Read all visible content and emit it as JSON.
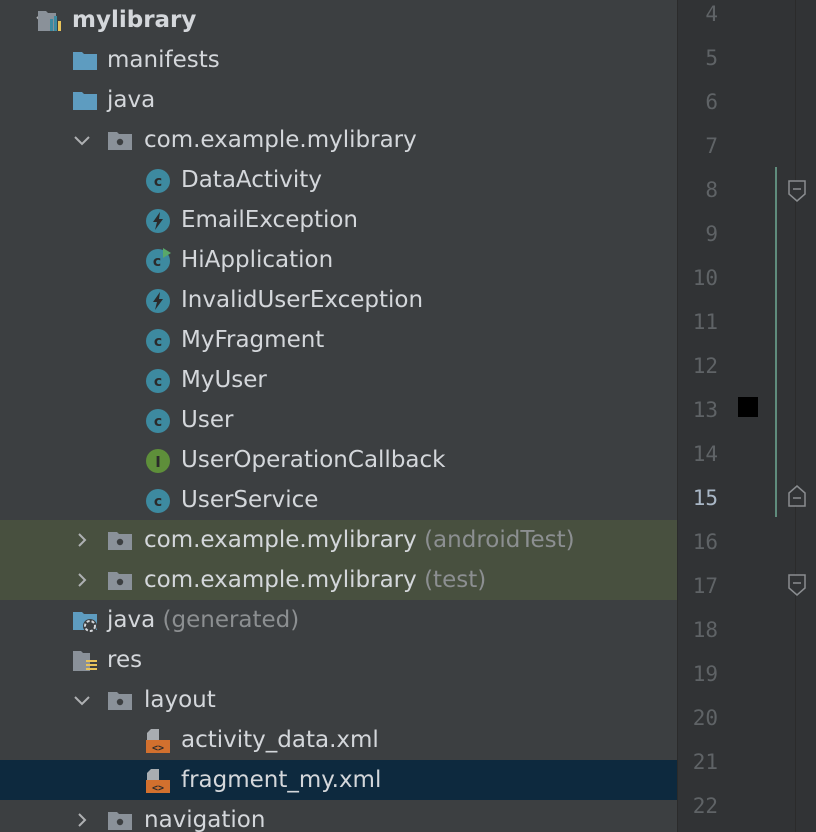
{
  "tree": {
    "rows": [
      {
        "label": "mylibrary",
        "hint": "",
        "bold": true,
        "indent": 0,
        "arrow": "down",
        "icon": "module-folder-icon",
        "style": ""
      },
      {
        "label": "manifests",
        "hint": "",
        "indent": 1,
        "arrow": "right",
        "icon": "folder-icon",
        "style": ""
      },
      {
        "label": "java",
        "hint": "",
        "indent": 1,
        "arrow": "down",
        "icon": "folder-icon",
        "style": ""
      },
      {
        "label": "com.example.mylibrary",
        "hint": "",
        "indent": 2,
        "arrow": "down",
        "icon": "package-icon",
        "style": ""
      },
      {
        "label": "DataActivity",
        "hint": "",
        "indent": 3,
        "arrow": "",
        "icon": "class-icon",
        "style": ""
      },
      {
        "label": "EmailException",
        "hint": "",
        "indent": 3,
        "arrow": "",
        "icon": "exception-icon",
        "style": ""
      },
      {
        "label": "HiApplication",
        "hint": "",
        "indent": 3,
        "arrow": "",
        "icon": "runnable-class-icon",
        "style": ""
      },
      {
        "label": "InvalidUserException",
        "hint": "",
        "indent": 3,
        "arrow": "",
        "icon": "exception-icon",
        "style": ""
      },
      {
        "label": "MyFragment",
        "hint": "",
        "indent": 3,
        "arrow": "",
        "icon": "class-icon",
        "style": ""
      },
      {
        "label": "MyUser",
        "hint": "",
        "indent": 3,
        "arrow": "",
        "icon": "class-icon",
        "style": ""
      },
      {
        "label": "User",
        "hint": "",
        "indent": 3,
        "arrow": "",
        "icon": "class-icon",
        "style": ""
      },
      {
        "label": "UserOperationCallback",
        "hint": "",
        "indent": 3,
        "arrow": "",
        "icon": "interface-icon",
        "style": ""
      },
      {
        "label": "UserService",
        "hint": "",
        "indent": 3,
        "arrow": "",
        "icon": "class-icon",
        "style": ""
      },
      {
        "label": "com.example.mylibrary",
        "hint": "(androidTest)",
        "indent": 2,
        "arrow": "right",
        "icon": "package-icon",
        "style": "tinted"
      },
      {
        "label": "com.example.mylibrary",
        "hint": "(test)",
        "indent": 2,
        "arrow": "right",
        "icon": "package-icon",
        "style": "tinted"
      },
      {
        "label": "java",
        "hint": "(generated)",
        "indent": 1,
        "arrow": "",
        "icon": "generated-folder-icon",
        "style": ""
      },
      {
        "label": "res",
        "hint": "",
        "indent": 1,
        "arrow": "down",
        "icon": "res-folder-icon",
        "style": ""
      },
      {
        "label": "layout",
        "hint": "",
        "indent": 2,
        "arrow": "down",
        "icon": "package-icon",
        "style": ""
      },
      {
        "label": "activity_data.xml",
        "hint": "",
        "indent": 3,
        "arrow": "",
        "icon": "layout-xml-icon",
        "style": ""
      },
      {
        "label": "fragment_my.xml",
        "hint": "",
        "indent": 3,
        "arrow": "",
        "icon": "layout-xml-icon",
        "style": "selected"
      },
      {
        "label": "navigation",
        "hint": "",
        "indent": 2,
        "arrow": "right",
        "icon": "package-icon",
        "style": ""
      }
    ]
  },
  "gutter": {
    "line_numbers": [
      "4",
      "5",
      "6",
      "7",
      "8",
      "9",
      "10",
      "11",
      "12",
      "13",
      "14",
      "15",
      "16",
      "17",
      "18",
      "19",
      "20",
      "21",
      "22"
    ],
    "current_line": "15"
  },
  "colors": {
    "tree_bg": "#3c3f41",
    "selected_row": "#0d293e",
    "tinted_row": "#48503f",
    "class_icon": "#3d8aa0",
    "interface_icon": "#5e8f3a",
    "folder_icon": "#5e9cc0",
    "xml_icon": "#d2702e"
  }
}
